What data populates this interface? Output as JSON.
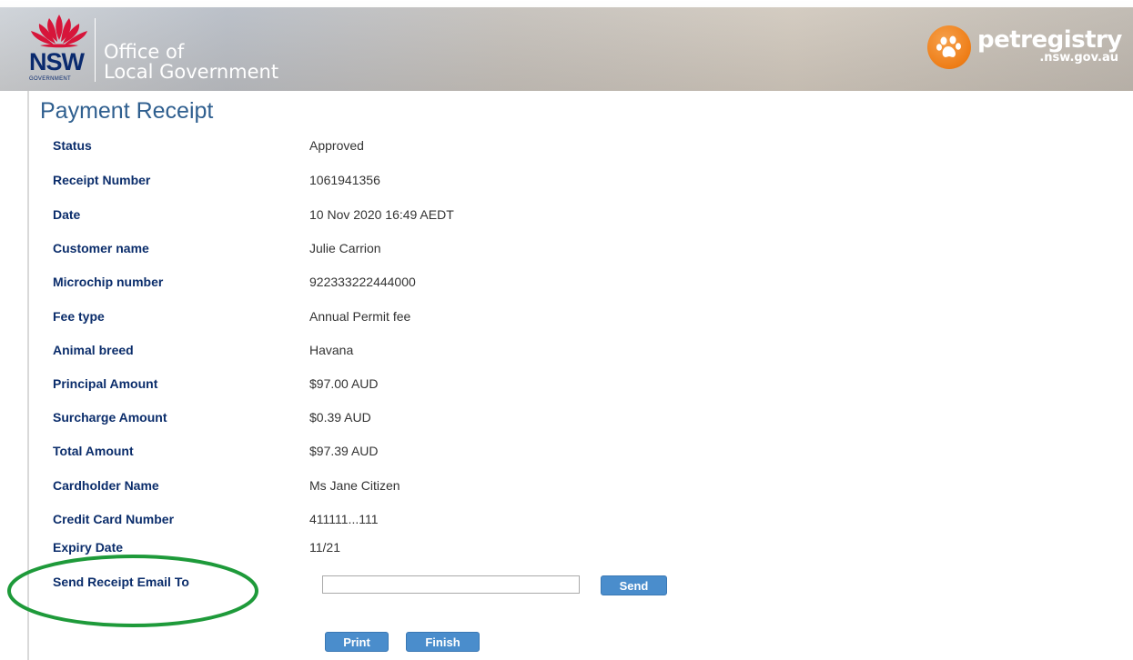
{
  "header": {
    "nsw_logo_text": "NSW",
    "nsw_gov_text": "GOVERNMENT",
    "org_line1": "Office of",
    "org_line2": "Local Government",
    "pet_registry_name": "petregistry",
    "pet_registry_domain": ".nsw.gov.au"
  },
  "page": {
    "title": "Payment Receipt"
  },
  "receipt": {
    "rows": [
      {
        "label": "Status",
        "value": "Approved"
      },
      {
        "label": "Receipt Number",
        "value": "1061941356"
      },
      {
        "label": "Date",
        "value": "10 Nov 2020 16:49 AEDT"
      },
      {
        "label": "Customer name",
        "value": "Julie Carrion"
      },
      {
        "label": "Microchip number",
        "value": "922333222444000"
      },
      {
        "label": "Fee type",
        "value": "Annual Permit fee"
      },
      {
        "label": "Animal breed",
        "value": "Havana"
      },
      {
        "label": "Principal Amount",
        "value": "$97.00 AUD"
      },
      {
        "label": "Surcharge Amount",
        "value": "$0.39 AUD"
      },
      {
        "label": "Total Amount",
        "value": "$97.39 AUD"
      },
      {
        "label": "Cardholder Name",
        "value": "Ms Jane Citizen"
      },
      {
        "label": "Credit Card Number",
        "value": "411111...111"
      },
      {
        "label": "Expiry Date",
        "value": "11/21"
      }
    ]
  },
  "email": {
    "label": "Send Receipt Email To",
    "value": "",
    "send_label": "Send"
  },
  "actions": {
    "print_label": "Print",
    "finish_label": "Finish"
  },
  "colors": {
    "label_text": "#0b2d6b",
    "title_text": "#2f5f8f",
    "button_bg": "#4a8dcc",
    "annotation": "#1e9a3a",
    "pet_badge": "#ee7d16"
  }
}
